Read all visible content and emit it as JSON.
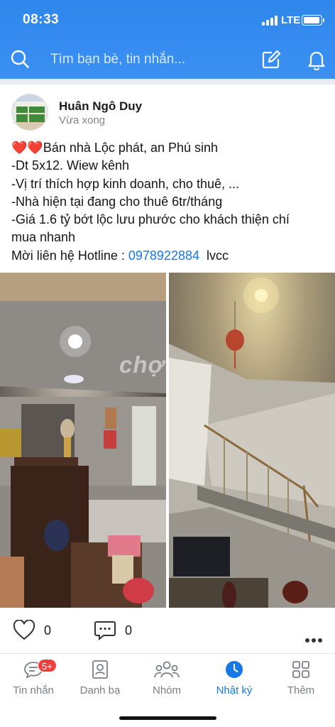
{
  "status_bar": {
    "time": "08:33",
    "network": "LTE"
  },
  "header": {
    "search_placeholder": "Tìm bạn bè, tin nhắn...",
    "icons": [
      "search-icon",
      "compose-icon",
      "bell-icon"
    ]
  },
  "post": {
    "author": "Huân Ngô Duy",
    "time": "Vừa xong",
    "hearts": "❤️❤️",
    "lines": [
      "Bán nhà Lộc phát, an Phú sinh",
      "-Dt 5x12. Wiew kênh",
      "-Vị trí thích hợp kinh doanh, cho thuê, ...",
      "-Nhà hiện tại đang cho thuê 6tr/tháng",
      "-Giá 1.6 tỷ bớt lộc lưu phước cho khách thiện chí",
      "mua nhanh"
    ],
    "hotline_label": "Mời liên hệ Hotline : ",
    "hotline_number": "0978922884",
    "hotline_suffix": "  lvcc",
    "watermark": "chợTỐT",
    "likes": "0",
    "comments": "0"
  },
  "tabs": [
    {
      "label": "Tin nhắn",
      "icon": "chat-icon",
      "badge": "5+"
    },
    {
      "label": "Danh bạ",
      "icon": "contacts-icon"
    },
    {
      "label": "Nhóm",
      "icon": "group-icon"
    },
    {
      "label": "Nhật ký",
      "icon": "clock-icon",
      "active": true
    },
    {
      "label": "Thêm",
      "icon": "grid-icon"
    }
  ],
  "colors": {
    "header_blue": "#2f86ec",
    "accent": "#1a78e6",
    "badge_red": "#f03d3d"
  }
}
